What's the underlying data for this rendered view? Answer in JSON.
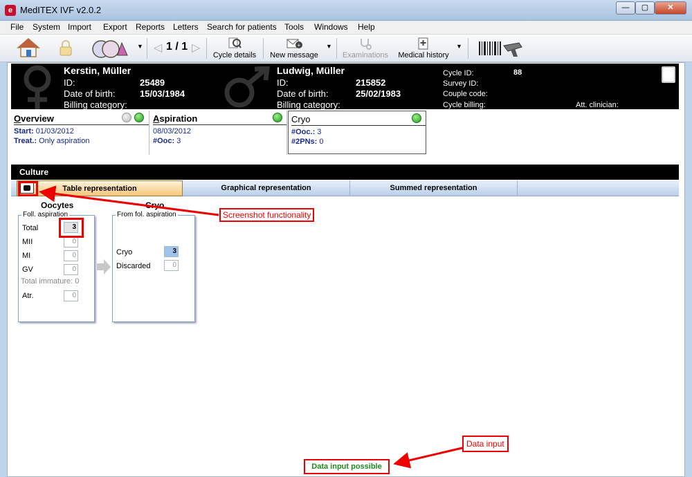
{
  "window": {
    "title": "MedITEX IVF v2.0.2",
    "icon_name": "meditex-logo-icon",
    "min_glyph": "—",
    "max_glyph": "▢",
    "close_glyph": "✕"
  },
  "menu": [
    "File",
    "System",
    "Import",
    "Export",
    "Reports",
    "Letters",
    "Search for patients",
    "Tools",
    "Windows",
    "Help"
  ],
  "toolbar": {
    "pager": "1 / 1",
    "cycle_details": "Cycle details",
    "new_message": "New message",
    "examinations": "Examinations",
    "medical_history": "Medical history"
  },
  "patient": {
    "female": {
      "name": "Kerstin, Müller",
      "id_label": "ID:",
      "id": "25489",
      "dob_label": "Date of birth:",
      "dob": "15/03/1984",
      "billing_label": "Billing category:"
    },
    "male": {
      "name": "Ludwig, Müller",
      "id_label": "ID:",
      "id": "215852",
      "dob_label": "Date of birth:",
      "dob": "25/02/1983",
      "billing_label": "Billing category:"
    },
    "cycle": {
      "cycle_id_label": "Cycle ID:",
      "cycle_id": "88",
      "survey_id_label": "Survey ID:",
      "couple_code_label": "Couple code:",
      "cycle_billing_label": "Cycle billing:",
      "att_clinician_label": "Att. clinician:"
    }
  },
  "summary": {
    "overview": {
      "title_first": "O",
      "title_rest": "verview",
      "start_label": "Start:",
      "start": "01/03/2012",
      "treat_label": "Treat.:",
      "treat": "Only aspiration"
    },
    "aspiration": {
      "title_first": "A",
      "title_rest": "spiration",
      "date": "08/03/2012",
      "ooc_label": "#Ooc:",
      "ooc": "3"
    },
    "cryo": {
      "title": "Cryo",
      "ooc_label": "#Ooc.:",
      "ooc": "3",
      "pns_label": "#2PNs:",
      "pns": "0"
    }
  },
  "culture": {
    "title": "Culture",
    "tabs": [
      "Table representation",
      "Graphical representation",
      "Summed representation"
    ],
    "active_tab": 0,
    "oocytes": {
      "title": "Oocytes",
      "group": "Foll. aspiration",
      "total_label": "Total",
      "total": "3",
      "mii_label": "MII",
      "mii": "0",
      "mi_label": "MI",
      "mi": "0",
      "gv_label": "GV",
      "gv": "0",
      "immature_label": "Total immature:",
      "immature": "0",
      "atr_label": "Atr.",
      "atr": "0"
    },
    "cryo": {
      "title": "Cryo",
      "group": "From fol. aspiration",
      "cryo_label": "Cryo",
      "cryo": "3",
      "discarded_label": "Discarded",
      "discarded": "0"
    }
  },
  "annotations": {
    "screenshot": "Screenshot functionality",
    "data_input": "Data input"
  },
  "status": "Data input possible",
  "colors": {
    "annotation_red": "#ee0000",
    "status_green": "#1f8a1f",
    "header_black": "#000000",
    "active_tab": "#f6c57a"
  }
}
